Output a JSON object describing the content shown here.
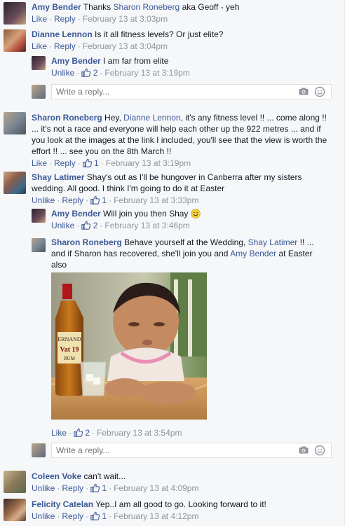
{
  "comments": [
    {
      "name": "Amy Bender",
      "text_pre": "Thanks ",
      "mention": "Sharon Roneberg",
      "text_post": " aka Geoff - yeh",
      "actions": [
        "Like",
        "Reply"
      ],
      "likes": "",
      "time": "February 13 at 3:03pm"
    },
    {
      "name": "Dianne Lennon",
      "text": "Is it all fitness levels? Or just elite?",
      "actions": [
        "Like",
        "Reply"
      ],
      "likes": "",
      "time": "February 13 at 3:04pm"
    },
    {
      "name": "Amy Bender",
      "text": "I am far from elite",
      "actions": [
        "Unlike"
      ],
      "likes": "2",
      "time": "February 13 at 3:19pm"
    },
    {
      "name": "Sharon Roneberg",
      "text_pre": "Hey, ",
      "mention": "Dianne Lennon",
      "text_post": ", it's any fitness level !! ... come along !! ... it's not a race and everyone will help each other up the 922 metres ... and if you look at the images at the link I included, you'll see that the view is worth the effort !! ... see you on the 8th March !!",
      "actions": [
        "Like",
        "Reply"
      ],
      "likes": "1",
      "time": "February 13 at 3:19pm"
    },
    {
      "name": "Shay Latimer",
      "text": "Shay's out as I'll be hungover in Canberra after my sisters wedding. All good. I think I'm going to do it at Easter",
      "actions": [
        "Unlike",
        "Reply"
      ],
      "likes": "1",
      "time": "February 13 at 3:33pm"
    },
    {
      "name": "Amy Bender",
      "text": "Will join you then Shay",
      "actions": [
        "Unlike"
      ],
      "likes": "2",
      "time": "February 13 at 3:46pm"
    },
    {
      "name": "Sharon Roneberg",
      "text_pre": "Behave yourself at the Wedding, ",
      "mention": "Shay Latimer",
      "text_mid": " !! ... and if Sharon has recovered, she'll join you and ",
      "mention2": "Amy Bender",
      "text_post": " at Easter also",
      "actions": [
        "Like"
      ],
      "likes": "2",
      "time": "February 13 at 3:54pm"
    },
    {
      "name": "Coleen Voke",
      "text": "can't wait...",
      "actions": [
        "Unlike",
        "Reply"
      ],
      "likes": "1",
      "time": "February 13 at 4:09pm"
    },
    {
      "name": "Felicity Catelan",
      "text": "Yep..I am all good to go. Looking forward to it!",
      "actions": [
        "Unlike",
        "Reply"
      ],
      "likes": "1",
      "time": "February 13 at 4:12pm"
    }
  ],
  "reply_placeholder": "Write a reply...",
  "photo": {
    "bottle_label_top": "ERNAND",
    "bottle_label_mid": "Vat 19",
    "bottle_label_bottom": "RUM"
  },
  "colors": {
    "link": "#3b5998",
    "meta": "#90949c",
    "background": "#f6f7f9"
  }
}
